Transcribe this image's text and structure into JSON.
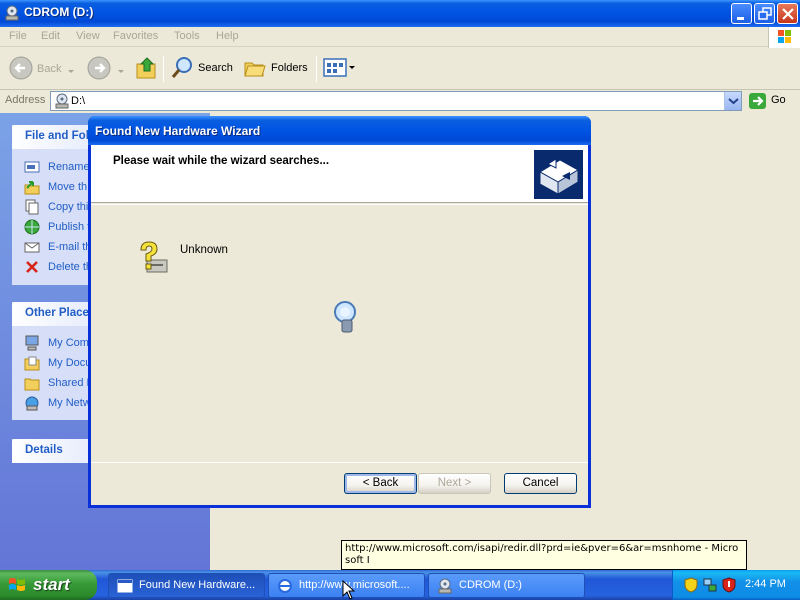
{
  "explorer": {
    "title": "CDROM (D:)",
    "menu": [
      "File",
      "Edit",
      "View",
      "Favorites",
      "Tools",
      "Help"
    ],
    "toolbar": {
      "back_label": "Back",
      "search_label": "Search",
      "folders_label": "Folders"
    },
    "address": {
      "label": "Address",
      "value": "D:\\",
      "go_label": "Go"
    },
    "file_tasks": {
      "title": "File and Fol",
      "items": [
        "Rename",
        "Move th",
        "Copy thi",
        "Publish t",
        "E-mail th",
        "Delete th"
      ]
    },
    "other_places": {
      "title": "Other Place",
      "items": [
        "My Comp",
        "My Docu",
        "Shared D",
        "My Netw"
      ]
    },
    "details": {
      "title": "Details"
    }
  },
  "wizard": {
    "title": "Found New Hardware Wizard",
    "heading": "Please wait while the wizard searches...",
    "device_name": "Unknown",
    "back_label": "< Back",
    "next_label": "Next >",
    "cancel_label": "Cancel"
  },
  "tooltip": {
    "text": "http://www.microsoft.com/isapi/redir.dll?prd=ie&pver=6&ar=msnhome - Microsoft I"
  },
  "taskbar": {
    "start_label": "start",
    "tasks": [
      "Found New Hardware...",
      "http://www.microsoft....",
      "CDROM (D:)"
    ],
    "clock": "2:44 PM"
  },
  "colors": {
    "xp_blue": "#0054e3",
    "start_green": "#379b37",
    "tray_blue": "#1290e8",
    "link_blue": "#215dc6"
  }
}
